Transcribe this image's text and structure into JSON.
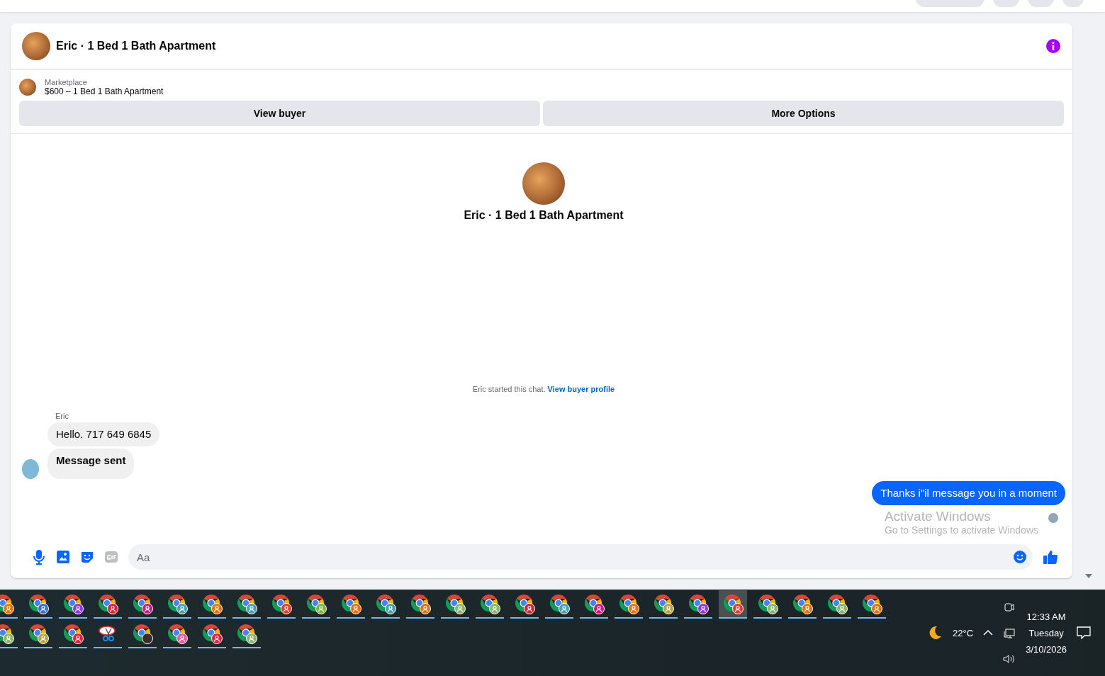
{
  "conversation": {
    "title": "Eric · 1 Bed 1 Bath Apartment"
  },
  "listing": {
    "source": "Marketplace",
    "summary": "$600 – 1 Bed 1 Bath Apartment"
  },
  "actions": [
    "View buyer",
    "More Options"
  ],
  "intro": {
    "title": "Eric · 1 Bed 1 Bath Apartment"
  },
  "system_message": {
    "text": "Eric started this chat.",
    "link": "View buyer profile"
  },
  "messages": [
    {
      "sender": "Eric",
      "text": "Hello. 717 649 6845",
      "outgoing": false,
      "bold": false
    },
    {
      "text": "Message sent",
      "outgoing": false,
      "bold": true
    },
    {
      "text": "Thanks i\"il message you in a moment",
      "outgoing": true,
      "bold": false
    }
  ],
  "composer": {
    "placeholder": "Aa"
  },
  "os_watermark": {
    "title": "Activate Windows",
    "subtitle": "Go to Settings to activate Windows"
  },
  "taskbar": {
    "rows": [
      [
        {
          "kind": "browser",
          "color": "#e8710a",
          "selected": false
        },
        {
          "kind": "browser",
          "color": "#3b6fd8",
          "selected": false
        },
        {
          "kind": "browser",
          "color": "#9334e6",
          "selected": false
        },
        {
          "kind": "browser",
          "color": "#e0203a",
          "selected": false
        },
        {
          "kind": "browser",
          "color": "#d01884",
          "selected": false
        },
        {
          "kind": "browser",
          "color": "#4a9fb5",
          "selected": false
        },
        {
          "kind": "browser",
          "color": "#e8710a",
          "selected": false
        },
        {
          "kind": "browser",
          "color": "#4a9fb5",
          "selected": false
        },
        {
          "kind": "browser",
          "color": "#e0402a",
          "selected": false
        },
        {
          "kind": "browser",
          "color": "#7cb342",
          "selected": false
        },
        {
          "kind": "browser",
          "color": "#e8710a",
          "selected": false
        },
        {
          "kind": "browser",
          "color": "#4a9fb5",
          "selected": false
        },
        {
          "kind": "browser",
          "color": "#e8710a",
          "selected": false
        },
        {
          "kind": "browser",
          "color": "#8bb56a",
          "selected": false
        },
        {
          "kind": "browser",
          "color": "#8bb56a",
          "selected": false
        },
        {
          "kind": "browser",
          "color": "#e0203a",
          "selected": false
        },
        {
          "kind": "browser",
          "color": "#4a9fb5",
          "selected": false
        },
        {
          "kind": "browser",
          "color": "#d01884",
          "selected": false
        },
        {
          "kind": "browser",
          "color": "#e8710a",
          "selected": false
        },
        {
          "kind": "browser",
          "color": "#b5a642",
          "selected": false
        },
        {
          "kind": "browser",
          "color": "#9334e6",
          "selected": false
        },
        {
          "kind": "browser",
          "color": "#e0402a",
          "selected": true
        },
        {
          "kind": "browser",
          "color": "#8bb56a",
          "selected": false
        },
        {
          "kind": "browser",
          "color": "#e8710a",
          "selected": false
        },
        {
          "kind": "browser",
          "color": "#8bb56a",
          "selected": false
        },
        {
          "kind": "browser",
          "color": "#e8710a",
          "selected": false
        }
      ],
      [
        {
          "kind": "browser",
          "color": "#8bb56a",
          "selected": false
        },
        {
          "kind": "browser",
          "color": "#b5a642",
          "selected": false
        },
        {
          "kind": "browser",
          "color": "#e0203a",
          "selected": false
        },
        {
          "kind": "snipping",
          "selected": false
        },
        {
          "kind": "browser",
          "color": "#3a2e28",
          "selected": false
        },
        {
          "kind": "browser",
          "color": "#e85aa0",
          "selected": false
        },
        {
          "kind": "browser",
          "color": "#e0203a",
          "selected": false
        },
        {
          "kind": "browser",
          "color": "#8bb56a",
          "selected": false
        }
      ]
    ],
    "weather": "22°C",
    "time": "12:33 AM",
    "day": "Tuesday",
    "date": "3/10/2026"
  }
}
